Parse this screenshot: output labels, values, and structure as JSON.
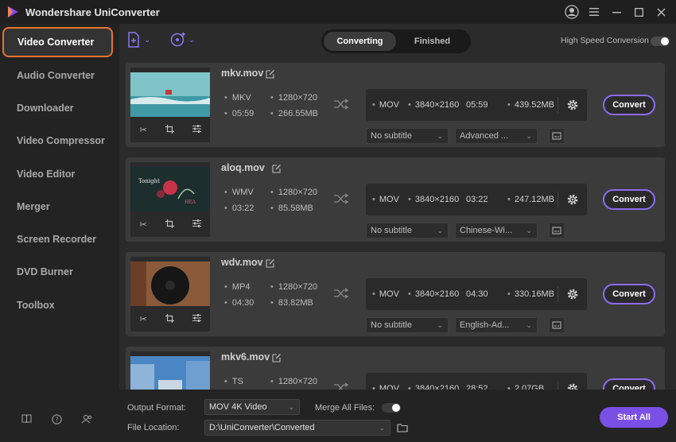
{
  "app": {
    "title": "Wondershare UniConverter"
  },
  "colors": {
    "accent": "#8a6cf0",
    "active_border": "#e8742d",
    "start_all": "#7a4fe6"
  },
  "sidebar": {
    "items": [
      {
        "label": "Video Converter",
        "active": true
      },
      {
        "label": "Audio Converter"
      },
      {
        "label": "Downloader"
      },
      {
        "label": "Video Compressor"
      },
      {
        "label": "Video Editor"
      },
      {
        "label": "Merger"
      },
      {
        "label": "Screen Recorder"
      },
      {
        "label": "DVD Burner"
      },
      {
        "label": "Toolbox"
      }
    ],
    "bottom_icons": [
      "book-icon",
      "help-icon",
      "account-icon"
    ]
  },
  "toolbar": {
    "tabs": [
      {
        "label": "Converting",
        "active": true
      },
      {
        "label": "Finished"
      }
    ],
    "high_speed_label": "High Speed Conversion"
  },
  "files": [
    {
      "name": "mkv.mov",
      "format": "MKV",
      "duration": "05:59",
      "resolution": "1280×720",
      "size": "266.55MB",
      "target": {
        "format": "MOV",
        "resolution": "3840×2160",
        "duration": "05:59",
        "size": "439.52MB"
      },
      "subtitle": "No subtitle",
      "audio": "Advanced ...",
      "convert_label": "Convert",
      "thumb": "ocean"
    },
    {
      "name": "aloq.mov",
      "format": "WMV",
      "duration": "03:22",
      "resolution": "1280×720",
      "size": "85.58MB",
      "target": {
        "format": "MOV",
        "resolution": "3840×2160",
        "duration": "03:22",
        "size": "247.12MB"
      },
      "subtitle": "No subtitle",
      "audio": "Chinese-Wi...",
      "convert_label": "Convert",
      "thumb": "floral"
    },
    {
      "name": "wdv.mov",
      "format": "MP4",
      "duration": "04:30",
      "resolution": "1280×720",
      "size": "83.82MB",
      "target": {
        "format": "MOV",
        "resolution": "3840×2160",
        "duration": "04:30",
        "size": "330.16MB"
      },
      "subtitle": "No subtitle",
      "audio": "English-Ad...",
      "convert_label": "Convert",
      "thumb": "vinyl"
    },
    {
      "name": "mkv6.mov",
      "format": "TS",
      "duration": "",
      "resolution": "1280×720",
      "size": "",
      "target": {
        "format": "MOV",
        "resolution": "3840×2160",
        "duration": "28:52",
        "size": "2.07GB"
      },
      "subtitle": "",
      "audio": "",
      "convert_label": "Convert",
      "thumb": "street"
    }
  ],
  "bottom": {
    "output_format_label": "Output Format:",
    "output_format_value": "MOV 4K Video",
    "merge_label": "Merge All Files:",
    "file_location_label": "File Location:",
    "file_location_value": "D:\\UniConverter\\Converted",
    "start_all_label": "Start All"
  }
}
